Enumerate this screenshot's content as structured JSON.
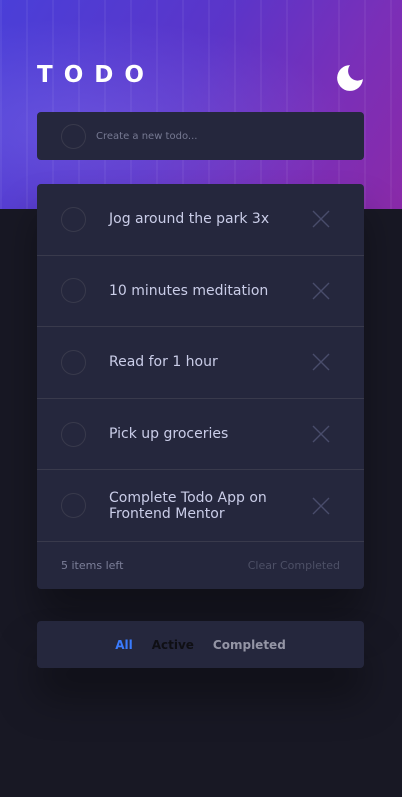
{
  "app": {
    "title": "TODO",
    "theme_toggle_icon": "moon-icon"
  },
  "create": {
    "placeholder": "Create a new todo..."
  },
  "todos": [
    {
      "text": "Jog around the park 3x",
      "completed": false
    },
    {
      "text": "10 minutes meditation",
      "completed": false
    },
    {
      "text": "Read for 1 hour",
      "completed": false
    },
    {
      "text": "Pick up groceries",
      "completed": false
    },
    {
      "text": "Complete Todo App on Frontend Mentor",
      "completed": false
    }
  ],
  "footer": {
    "items_left": "5 items left",
    "clear_label": "Clear Completed"
  },
  "filters": {
    "all": "All",
    "active": "Active",
    "completed": "Completed",
    "selected": "All"
  },
  "colors": {
    "accent": "#3a7bfd",
    "card": "#25273d",
    "background": "#181824"
  }
}
